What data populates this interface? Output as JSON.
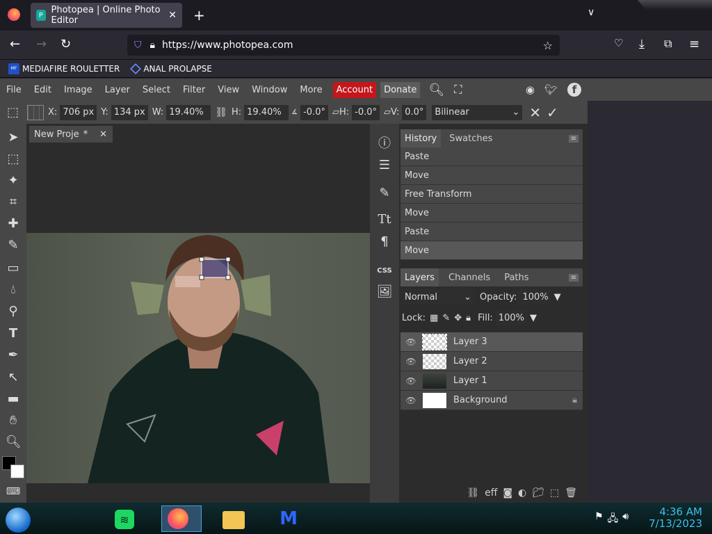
{
  "browser": {
    "tab_title": "Photopea | Online Photo Editor",
    "url": "https://www.photopea.com",
    "bookmarks": [
      {
        "label": "MEDIAFIRE ROULETTER"
      },
      {
        "label": "ANAL PROLAPSE"
      }
    ]
  },
  "menu": {
    "items": [
      "File",
      "Edit",
      "Image",
      "Layer",
      "Select",
      "Filter",
      "View",
      "Window",
      "More"
    ],
    "account": "Account",
    "donate": "Donate"
  },
  "options": {
    "x_label": "X:",
    "x": "706 px",
    "y_label": "Y:",
    "y": "134 px",
    "w_label": "W:",
    "w": "19.40%",
    "h_label": "H:",
    "h": "19.40%",
    "rot": "-0.0°",
    "skew_h_label": "H:",
    "skew_h": "-0.0°",
    "skew_v_label": "V:",
    "skew_v": "0.0°",
    "interp": "Bilinear"
  },
  "document": {
    "tab_name": "New Proje",
    "modified_mark": "*"
  },
  "history": {
    "tabs": [
      "History",
      "Swatches"
    ],
    "items": [
      "Paste",
      "Move",
      "Free Transform",
      "Move",
      "Paste",
      "Move"
    ]
  },
  "layers_panel": {
    "tabs": [
      "Layers",
      "Channels",
      "Paths"
    ],
    "blend_mode": "Normal",
    "opacity_label": "Opacity:",
    "opacity": "100%",
    "lock_label": "Lock:",
    "fill_label": "Fill:",
    "fill": "100%",
    "layers": [
      "Layer 3",
      "Layer 2",
      "Layer 1",
      "Background"
    ]
  },
  "sidepanel": {
    "css_label": "CSS"
  },
  "taskbar": {
    "time": "4:36 AM",
    "date": "7/13/2023"
  }
}
